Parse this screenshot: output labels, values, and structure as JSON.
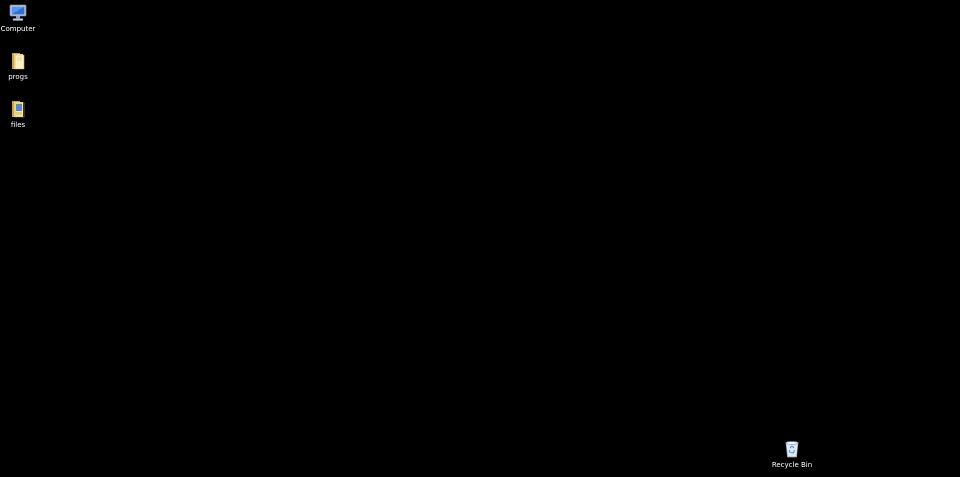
{
  "desktop": {
    "background_color": "#000000",
    "icons": [
      {
        "label": "Computer",
        "icon": "computer-icon"
      },
      {
        "label": "progs",
        "icon": "folder-icon"
      },
      {
        "label": "files",
        "icon": "folder-icon"
      },
      {
        "label": "Recycle Bin",
        "icon": "recycle-bin-icon"
      }
    ]
  }
}
